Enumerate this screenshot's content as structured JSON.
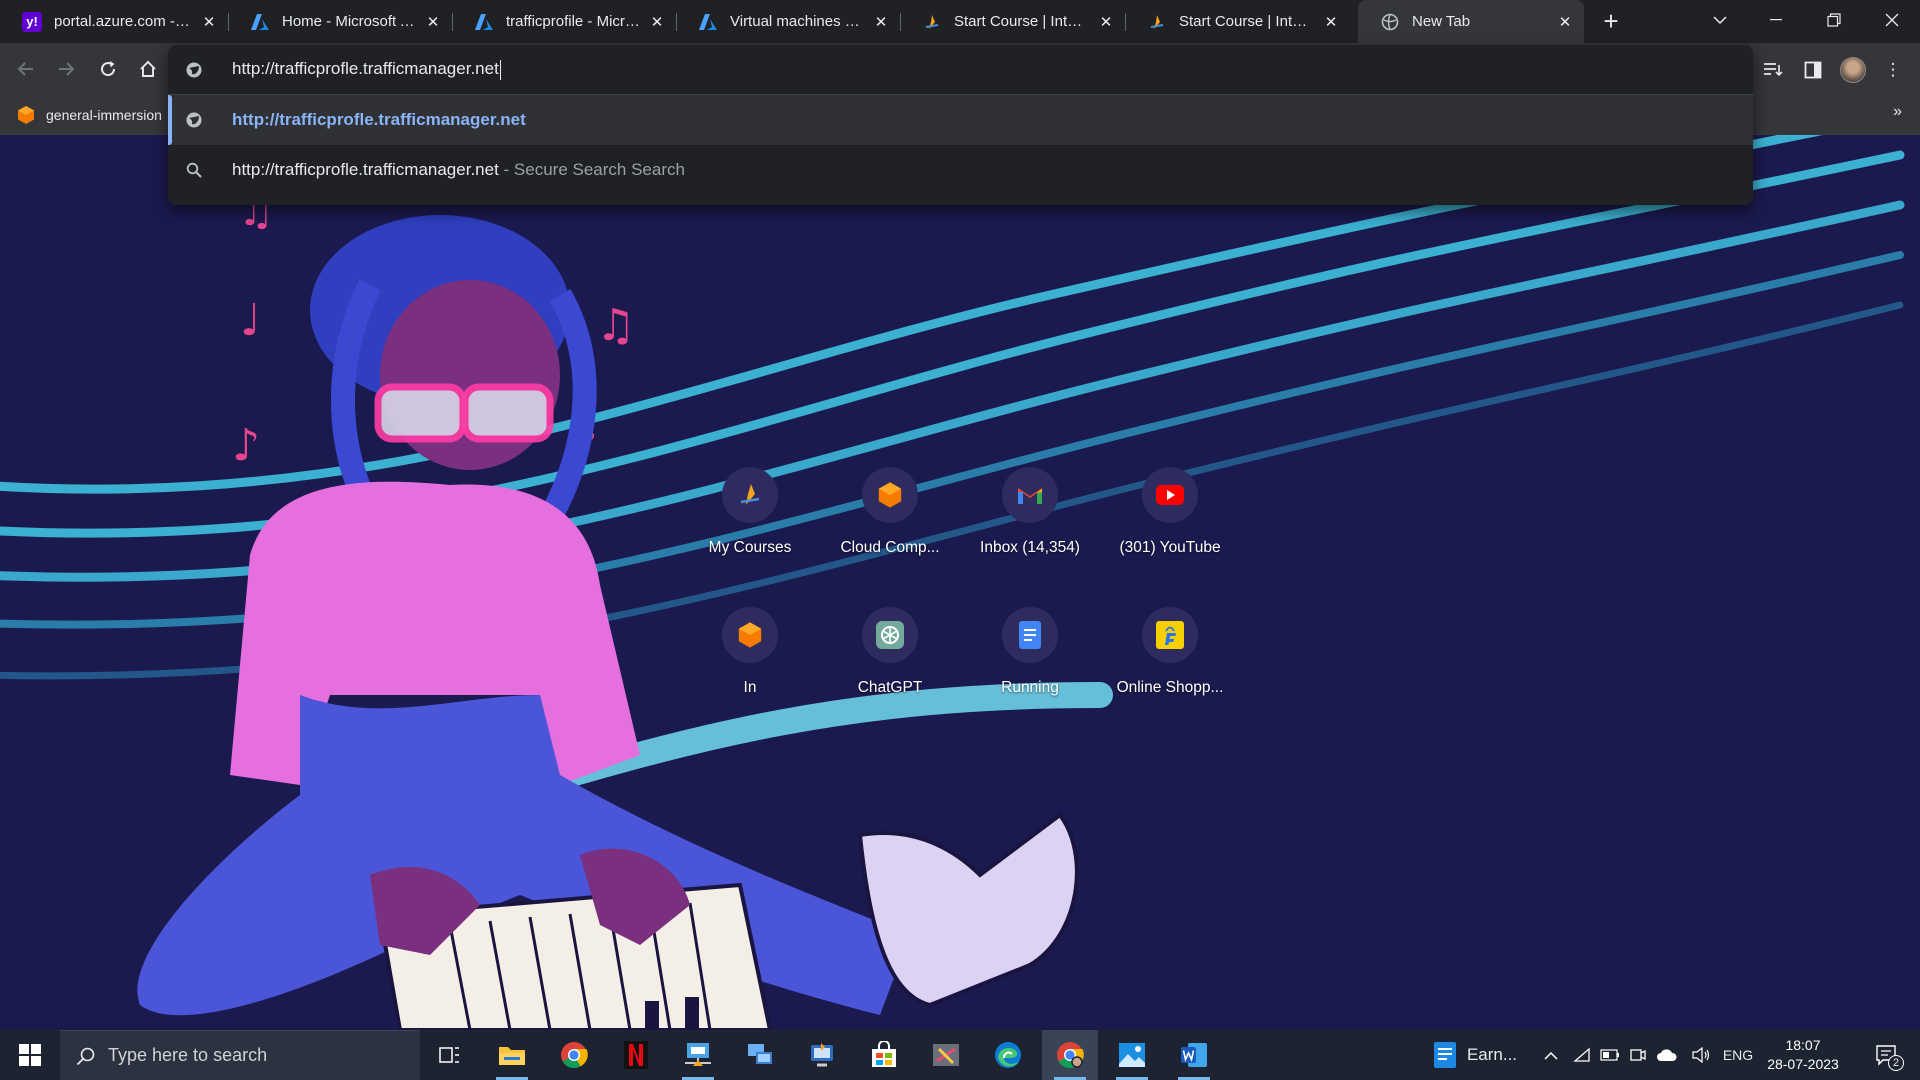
{
  "tabs": [
    {
      "title": "portal.azure.com - Yahoo",
      "favicon": "yahoo-icon",
      "active": false
    },
    {
      "title": "Home - Microsoft Azure",
      "favicon": "azure-icon",
      "active": false
    },
    {
      "title": "trafficprofile - Microsoft Azure",
      "favicon": "azure-icon",
      "active": false
    },
    {
      "title": "Virtual machines - Microsoft Azure",
      "favicon": "azure-icon",
      "active": false
    },
    {
      "title": "Start Course | Intellipaat",
      "favicon": "intellipaat-icon",
      "active": false
    },
    {
      "title": "Start Course | Intellipaat",
      "favicon": "intellipaat-icon",
      "active": false
    },
    {
      "title": "New Tab",
      "favicon": "chrome-newtab-icon",
      "active": true
    }
  ],
  "bookmarks": {
    "item_label": "general-immersion",
    "more_label": "»"
  },
  "omnibox": {
    "input_value": "http://trafficprofle.trafficmanager.net",
    "suggestion_url": "http://trafficprofle.trafficmanager.net",
    "suggestion_search_query": "http://trafficprofle.trafficmanager.net",
    "suggestion_search_suffix": " - Secure Search Search"
  },
  "shortcuts": [
    {
      "label": "My Courses",
      "icon": "intellipaat-icon"
    },
    {
      "label": "Cloud Comp...",
      "icon": "orange-cube-icon"
    },
    {
      "label": "Inbox (14,354)",
      "icon": "gmail-icon"
    },
    {
      "label": "(301) YouTube",
      "icon": "youtube-icon"
    },
    {
      "label": "In",
      "icon": "orange-cube-icon"
    },
    {
      "label": "ChatGPT",
      "icon": "chatgpt-icon"
    },
    {
      "label": "Running",
      "icon": "docs-icon"
    },
    {
      "label": "Online Shopp...",
      "icon": "flipkart-icon"
    }
  ],
  "taskbar": {
    "search_placeholder": "Type here to search",
    "weather_label": "Earn...",
    "language": "ENG",
    "time": "18:07",
    "date": "28-07-2023",
    "notification_count": "2"
  },
  "colors": {
    "accent": "#8ab4f8",
    "page_bg": "#1b1a4f",
    "taskbar_bg": "#1d2331",
    "tabstrip_bg": "#202124"
  }
}
